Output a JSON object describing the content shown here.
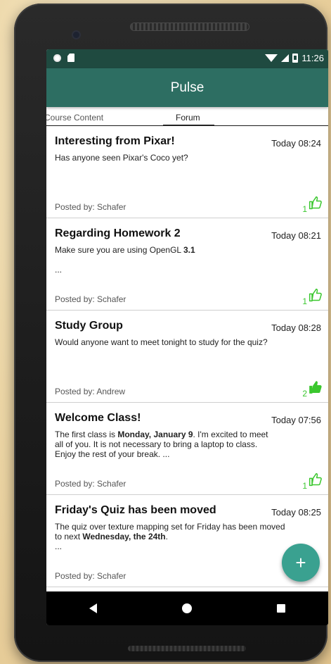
{
  "status_bar": {
    "time": "11:26"
  },
  "app_bar": {
    "title": "Pulse"
  },
  "tabs": [
    {
      "label": "Course Content",
      "selected": false
    },
    {
      "label": "Forum",
      "selected": true
    }
  ],
  "colors": {
    "status_bar": "#1f4a40",
    "app_bar": "#2d6e62",
    "fab": "#3aa190",
    "like_green": "#3bc72f"
  },
  "posts": [
    {
      "title": "Interesting from Pixar!",
      "time": "Today 08:24",
      "body_html": "Has anyone seen Pixar's Coco yet?",
      "posted_by": "Posted by: Schafer",
      "likes": "1",
      "liked": false
    },
    {
      "title": "Regarding Homework 2",
      "time": "Today 08:21",
      "body_html": "Make sure you are using OpenGL <b>3.1</b>\n\n...",
      "posted_by": "Posted by: Schafer",
      "likes": "1",
      "liked": false
    },
    {
      "title": "Study Group",
      "time": "Today 08:28",
      "body_html": "Would anyone want to meet tonight to study for the quiz?",
      "posted_by": "Posted by: Andrew",
      "likes": "2",
      "liked": true
    },
    {
      "title": "Welcome Class!",
      "time": "Today 07:56",
      "body_html": "The first class is <b>Monday, January 9</b>. I'm excited to meet\nall of you. It is not necessary to bring a laptop to class.\nEnjoy the rest of your break. ...",
      "posted_by": "Posted by: Schafer",
      "likes": "1",
      "liked": false
    },
    {
      "title": "Friday's Quiz has been moved",
      "time": "Today 08:25",
      "body_html": "The quiz over texture mapping set for Friday has been moved\nto next <b>Wednesday, the 24th</b>.\n...",
      "posted_by": "Posted by: Schafer",
      "likes": "",
      "liked": false
    }
  ],
  "fab": {
    "icon": "plus-icon",
    "label": "+"
  },
  "nav_icons": [
    "back-icon",
    "home-icon",
    "recents-icon"
  ]
}
